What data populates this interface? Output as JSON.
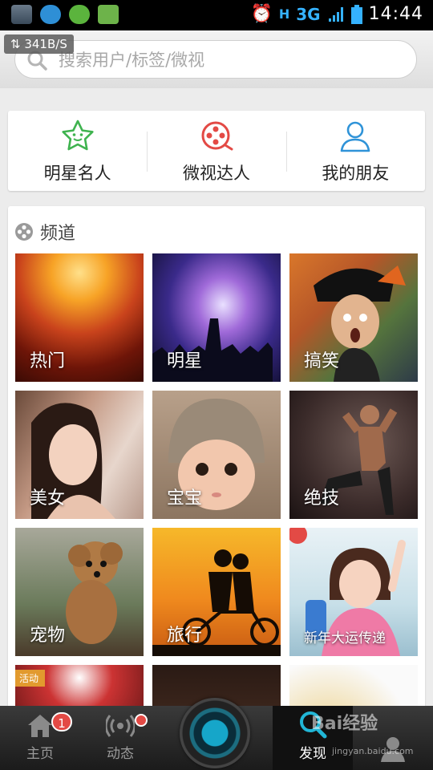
{
  "status_bar": {
    "network": "3G",
    "signal_letter": "H",
    "time": "14:44",
    "speed": "341B/S"
  },
  "search": {
    "placeholder": "搜索用户/标签/微视"
  },
  "quick_links": [
    {
      "label": "明星名人",
      "icon": "star-icon"
    },
    {
      "label": "微视达人",
      "icon": "film-reel-icon"
    },
    {
      "label": "我的朋友",
      "icon": "person-icon"
    }
  ],
  "channels": {
    "title": "频道",
    "items": [
      {
        "label": "热门"
      },
      {
        "label": "明星"
      },
      {
        "label": "搞笑"
      },
      {
        "label": "美女"
      },
      {
        "label": "宝宝"
      },
      {
        "label": "绝技"
      },
      {
        "label": "宠物"
      },
      {
        "label": "旅行"
      },
      {
        "label": "新年大运传递"
      }
    ],
    "partial_badge": "活动"
  },
  "tabbar": {
    "tabs": [
      {
        "label": "主页",
        "badge": "1"
      },
      {
        "label": "动态"
      },
      {
        "label": "发现"
      }
    ]
  },
  "watermark": {
    "brand": "Bai经验",
    "url": "jingyan.baidu.com"
  },
  "colors": {
    "accent_green": "#3fb34f",
    "accent_red": "#e34a45",
    "accent_blue": "#2f93d8",
    "tab_active_blue": "#21b6d6"
  }
}
